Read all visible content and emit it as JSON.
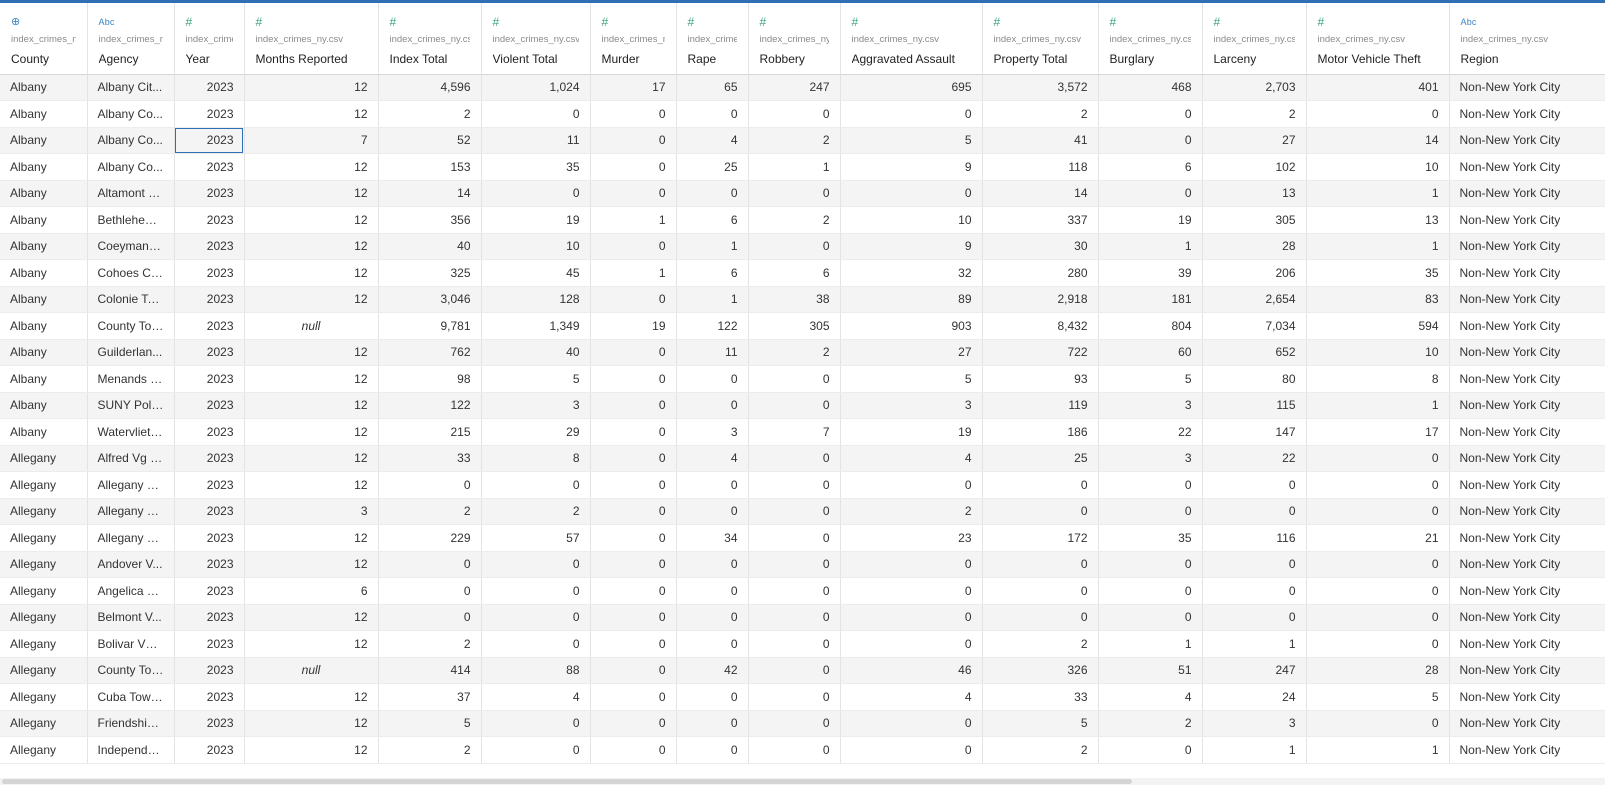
{
  "columns": [
    {
      "key": "county",
      "name": "County",
      "source": "index_crimes_ny.csv",
      "type": "geo",
      "icon": "globe-icon",
      "align": "txt"
    },
    {
      "key": "agency",
      "name": "Agency",
      "source": "index_crimes_ny.csv",
      "type": "abc",
      "icon": "string-type-icon",
      "align": "txt"
    },
    {
      "key": "year",
      "name": "Year",
      "source": "index_crimes_ny.csv",
      "type": "num",
      "icon": "number-type-icon",
      "align": "num"
    },
    {
      "key": "months",
      "name": "Months Reported",
      "source": "index_crimes_ny.csv",
      "type": "num",
      "icon": "number-type-icon",
      "align": "num"
    },
    {
      "key": "index_total",
      "name": "Index Total",
      "source": "index_crimes_ny.csv",
      "type": "num",
      "icon": "number-type-icon",
      "align": "num"
    },
    {
      "key": "violent_total",
      "name": "Violent Total",
      "source": "index_crimes_ny.csv",
      "type": "num",
      "icon": "number-type-icon",
      "align": "num"
    },
    {
      "key": "murder",
      "name": "Murder",
      "source": "index_crimes_ny.csv",
      "type": "num",
      "icon": "number-type-icon",
      "align": "num"
    },
    {
      "key": "rape",
      "name": "Rape",
      "source": "index_crimes_ny.csv",
      "type": "num",
      "icon": "number-type-icon",
      "align": "num"
    },
    {
      "key": "robbery",
      "name": "Robbery",
      "source": "index_crimes_ny.csv",
      "type": "num",
      "icon": "number-type-icon",
      "align": "num"
    },
    {
      "key": "agg_assault",
      "name": "Aggravated Assault",
      "source": "index_crimes_ny.csv",
      "type": "num",
      "icon": "number-type-icon",
      "align": "num"
    },
    {
      "key": "property_total",
      "name": "Property Total",
      "source": "index_crimes_ny.csv",
      "type": "num",
      "icon": "number-type-icon",
      "align": "num"
    },
    {
      "key": "burglary",
      "name": "Burglary",
      "source": "index_crimes_ny.csv",
      "type": "num",
      "icon": "number-type-icon",
      "align": "num"
    },
    {
      "key": "larceny",
      "name": "Larceny",
      "source": "index_crimes_ny.csv",
      "type": "num",
      "icon": "number-type-icon",
      "align": "num"
    },
    {
      "key": "mvt",
      "name": "Motor Vehicle Theft",
      "source": "index_crimes_ny.csv",
      "type": "num",
      "icon": "number-type-icon",
      "align": "num"
    },
    {
      "key": "region",
      "name": "Region",
      "source": "index_crimes_ny.csv",
      "type": "abc",
      "icon": "string-type-icon",
      "align": "txt"
    }
  ],
  "type_glyphs": {
    "geo": "⊕",
    "abc": "Abc",
    "num": "#"
  },
  "null_label": "null",
  "selected_cell": {
    "row": 2,
    "col": "year"
  },
  "rows": [
    [
      "Albany",
      "Albany Cit...",
      "2023",
      "12",
      "4,596",
      "1,024",
      "17",
      "65",
      "247",
      "695",
      "3,572",
      "468",
      "2,703",
      "401",
      "Non-New York City"
    ],
    [
      "Albany",
      "Albany Co...",
      "2023",
      "12",
      "2",
      "0",
      "0",
      "0",
      "0",
      "0",
      "2",
      "0",
      "2",
      "0",
      "Non-New York City"
    ],
    [
      "Albany",
      "Albany Co...",
      "2023",
      "7",
      "52",
      "11",
      "0",
      "4",
      "2",
      "5",
      "41",
      "0",
      "27",
      "14",
      "Non-New York City"
    ],
    [
      "Albany",
      "Albany Co...",
      "2023",
      "12",
      "153",
      "35",
      "0",
      "25",
      "1",
      "9",
      "118",
      "6",
      "102",
      "10",
      "Non-New York City"
    ],
    [
      "Albany",
      "Altamont V...",
      "2023",
      "12",
      "14",
      "0",
      "0",
      "0",
      "0",
      "0",
      "14",
      "0",
      "13",
      "1",
      "Non-New York City"
    ],
    [
      "Albany",
      "Bethlehem...",
      "2023",
      "12",
      "356",
      "19",
      "1",
      "6",
      "2",
      "10",
      "337",
      "19",
      "305",
      "13",
      "Non-New York City"
    ],
    [
      "Albany",
      "Coeymans ...",
      "2023",
      "12",
      "40",
      "10",
      "0",
      "1",
      "0",
      "9",
      "30",
      "1",
      "28",
      "1",
      "Non-New York City"
    ],
    [
      "Albany",
      "Cohoes Cit...",
      "2023",
      "12",
      "325",
      "45",
      "1",
      "6",
      "6",
      "32",
      "280",
      "39",
      "206",
      "35",
      "Non-New York City"
    ],
    [
      "Albany",
      "Colonie To...",
      "2023",
      "12",
      "3,046",
      "128",
      "0",
      "1",
      "38",
      "89",
      "2,918",
      "181",
      "2,654",
      "83",
      "Non-New York City"
    ],
    [
      "Albany",
      "County Total",
      "2023",
      null,
      "9,781",
      "1,349",
      "19",
      "122",
      "305",
      "903",
      "8,432",
      "804",
      "7,034",
      "594",
      "Non-New York City"
    ],
    [
      "Albany",
      "Guilderlan...",
      "2023",
      "12",
      "762",
      "40",
      "0",
      "11",
      "2",
      "27",
      "722",
      "60",
      "652",
      "10",
      "Non-New York City"
    ],
    [
      "Albany",
      "Menands V...",
      "2023",
      "12",
      "98",
      "5",
      "0",
      "0",
      "0",
      "5",
      "93",
      "5",
      "80",
      "8",
      "Non-New York City"
    ],
    [
      "Albany",
      "SUNY Polic...",
      "2023",
      "12",
      "122",
      "3",
      "0",
      "0",
      "0",
      "3",
      "119",
      "3",
      "115",
      "1",
      "Non-New York City"
    ],
    [
      "Albany",
      "Watervliet ...",
      "2023",
      "12",
      "215",
      "29",
      "0",
      "3",
      "7",
      "19",
      "186",
      "22",
      "147",
      "17",
      "Non-New York City"
    ],
    [
      "Allegany",
      "Alfred Vg PD",
      "2023",
      "12",
      "33",
      "8",
      "0",
      "4",
      "0",
      "4",
      "25",
      "3",
      "22",
      "0",
      "Non-New York City"
    ],
    [
      "Allegany",
      "Allegany C...",
      "2023",
      "12",
      "0",
      "0",
      "0",
      "0",
      "0",
      "0",
      "0",
      "0",
      "0",
      "0",
      "Non-New York City"
    ],
    [
      "Allegany",
      "Allegany C...",
      "2023",
      "3",
      "2",
      "2",
      "0",
      "0",
      "0",
      "2",
      "0",
      "0",
      "0",
      "0",
      "Non-New York City"
    ],
    [
      "Allegany",
      "Allegany C...",
      "2023",
      "12",
      "229",
      "57",
      "0",
      "34",
      "0",
      "23",
      "172",
      "35",
      "116",
      "21",
      "Non-New York City"
    ],
    [
      "Allegany",
      "Andover V...",
      "2023",
      "12",
      "0",
      "0",
      "0",
      "0",
      "0",
      "0",
      "0",
      "0",
      "0",
      "0",
      "Non-New York City"
    ],
    [
      "Allegany",
      "Angelica V...",
      "2023",
      "6",
      "0",
      "0",
      "0",
      "0",
      "0",
      "0",
      "0",
      "0",
      "0",
      "0",
      "Non-New York City"
    ],
    [
      "Allegany",
      "Belmont V...",
      "2023",
      "12",
      "0",
      "0",
      "0",
      "0",
      "0",
      "0",
      "0",
      "0",
      "0",
      "0",
      "Non-New York City"
    ],
    [
      "Allegany",
      "Bolivar Vg ...",
      "2023",
      "12",
      "2",
      "0",
      "0",
      "0",
      "0",
      "0",
      "2",
      "1",
      "1",
      "0",
      "Non-New York City"
    ],
    [
      "Allegany",
      "County Total",
      "2023",
      null,
      "414",
      "88",
      "0",
      "42",
      "0",
      "46",
      "326",
      "51",
      "247",
      "28",
      "Non-New York City"
    ],
    [
      "Allegany",
      "Cuba Town...",
      "2023",
      "12",
      "37",
      "4",
      "0",
      "0",
      "0",
      "4",
      "33",
      "4",
      "24",
      "5",
      "Non-New York City"
    ],
    [
      "Allegany",
      "Friendship ...",
      "2023",
      "12",
      "5",
      "0",
      "0",
      "0",
      "0",
      "0",
      "5",
      "2",
      "3",
      "0",
      "Non-New York City"
    ],
    [
      "Allegany",
      "Independe...",
      "2023",
      "12",
      "2",
      "0",
      "0",
      "0",
      "0",
      "0",
      "2",
      "0",
      "1",
      "1",
      "Non-New York City"
    ]
  ]
}
